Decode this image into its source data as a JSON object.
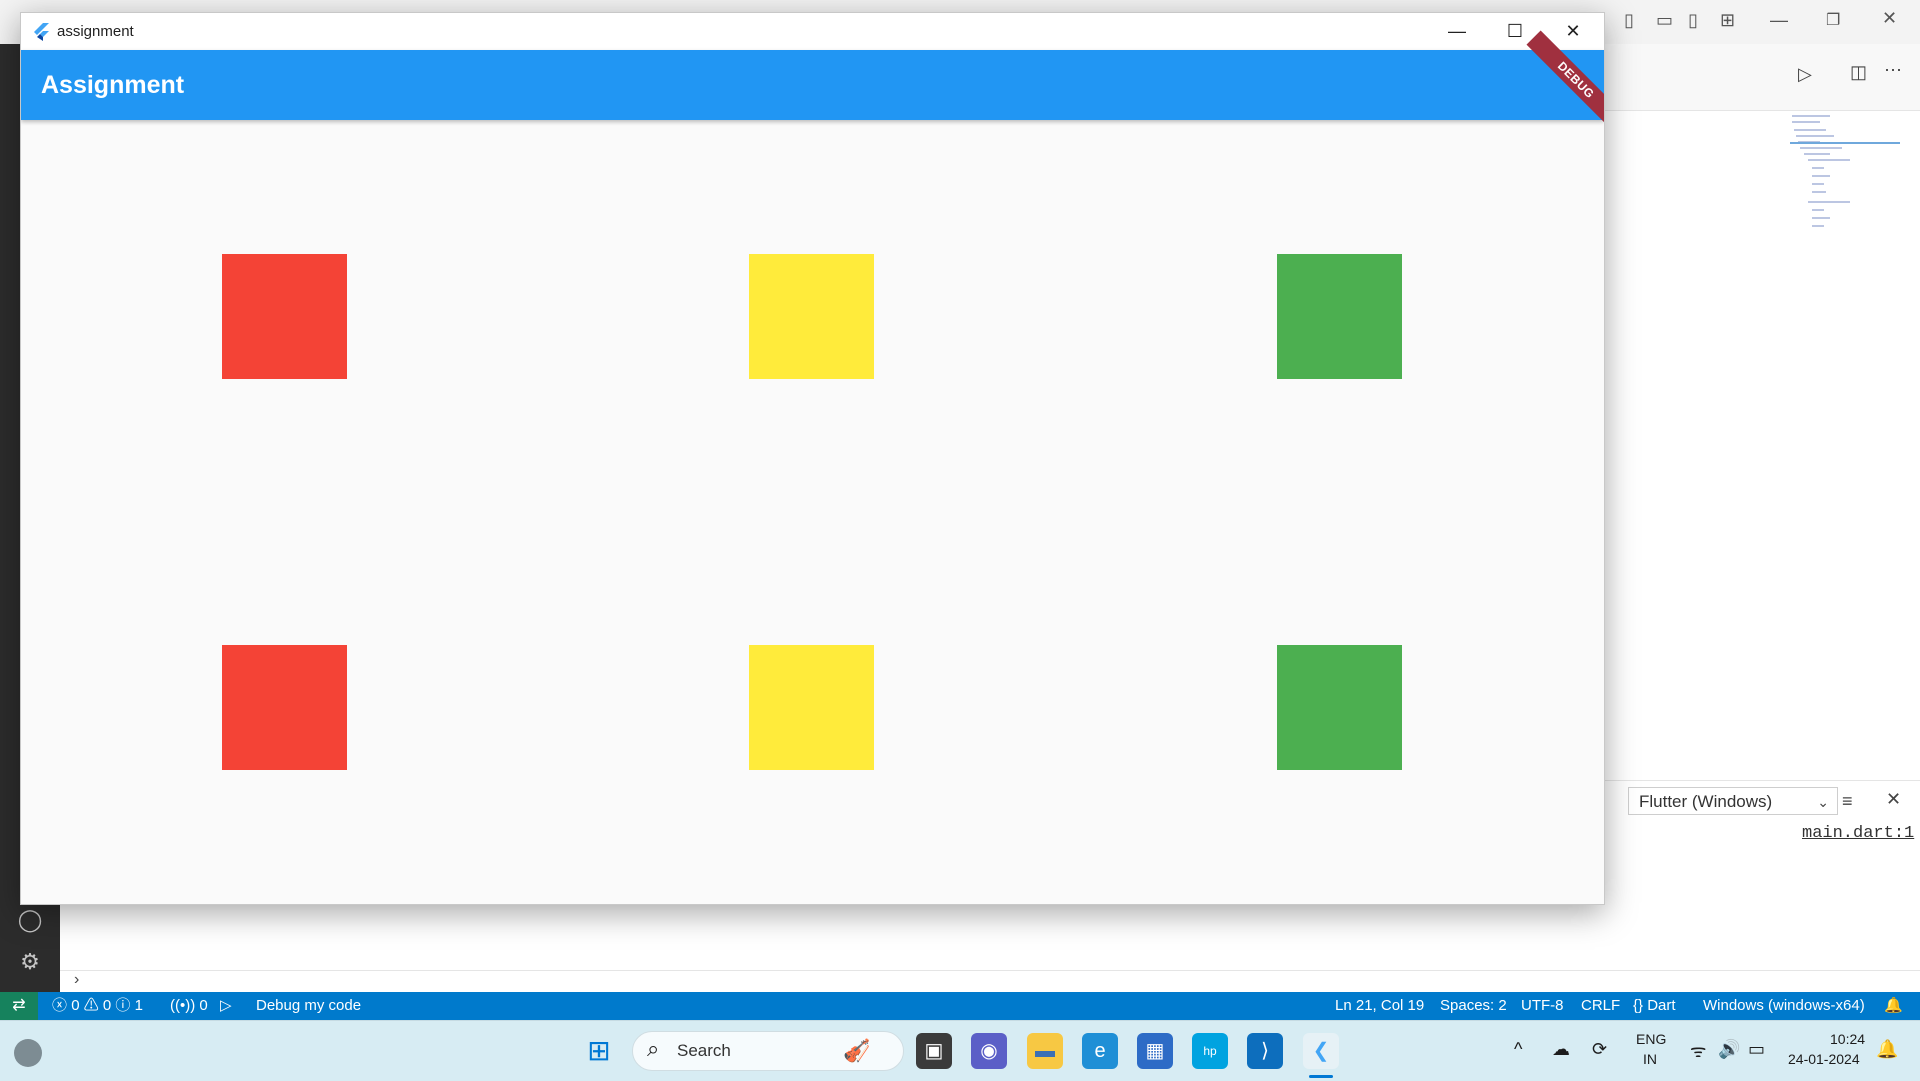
{
  "app_window": {
    "title": "assignment",
    "controls": {
      "minimize": "—",
      "maximize": "☐",
      "close": "✕"
    },
    "appbar_title": "Assignment",
    "debug_banner": "DEBUG",
    "boxes": [
      {
        "row": 1,
        "col": 1,
        "color": "#f44336"
      },
      {
        "row": 1,
        "col": 2,
        "color": "#ffeb3b"
      },
      {
        "row": 1,
        "col": 3,
        "color": "#4caf50"
      },
      {
        "row": 2,
        "col": 1,
        "color": "#f44336"
      },
      {
        "row": 2,
        "col": 2,
        "color": "#ffeb3b"
      },
      {
        "row": 2,
        "col": 3,
        "color": "#4caf50"
      }
    ]
  },
  "vscode": {
    "panel": {
      "debug_target": "Flutter (Windows)",
      "link": "main.dart:1"
    },
    "statusbar": {
      "errors": "0",
      "warnings": "0",
      "info": "1",
      "ports": "0",
      "debug_label": "Debug my code",
      "cursor_position": "Ln 21, Col 19",
      "indentation": "Spaces: 2",
      "encoding": "UTF-8",
      "line_ending": "CRLF",
      "language": "Dart",
      "device": "Windows (windows-x64)"
    },
    "colors": {
      "statusbar": "#007acc",
      "remote": "#16825d"
    }
  },
  "taskbar": {
    "search_placeholder": "Search",
    "language": "ENG",
    "region": "IN",
    "time": "10:24",
    "date": "24-01-2024",
    "icons": [
      "windows-start-icon",
      "task-view-icon",
      "teams-chat-icon",
      "file-explorer-icon",
      "edge-icon",
      "microsoft-store-icon",
      "myhp-icon",
      "vscode-icon",
      "flutter-app-icon"
    ]
  }
}
